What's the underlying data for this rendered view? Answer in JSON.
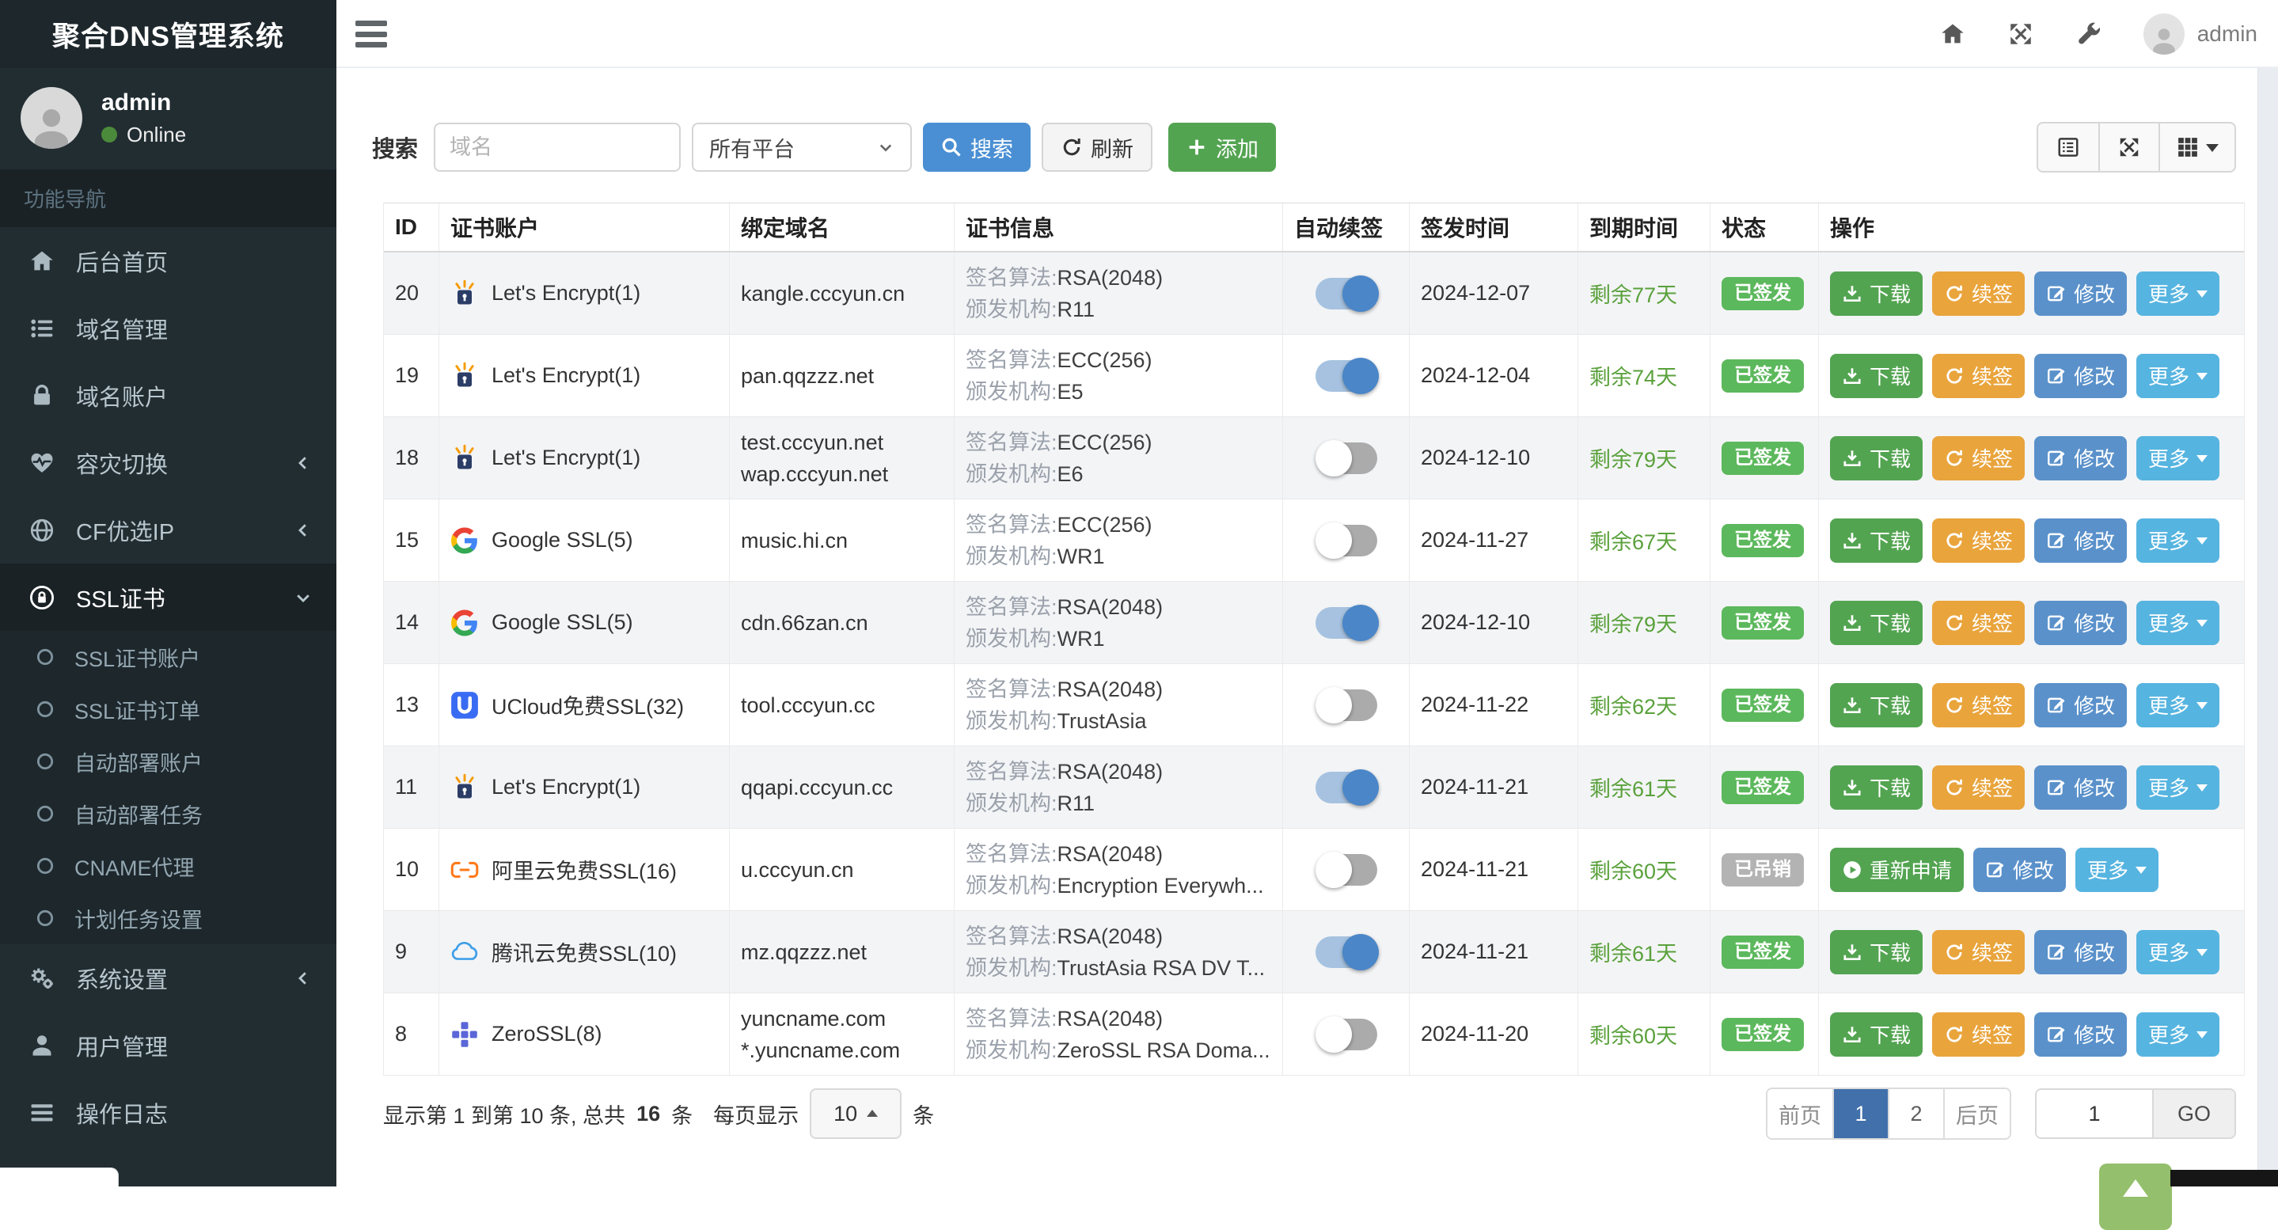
{
  "app": {
    "title": "聚合DNS管理系统"
  },
  "topbar": {
    "username": "admin"
  },
  "sidebar": {
    "user": {
      "name": "admin",
      "status": "Online"
    },
    "section_label": "功能导航",
    "items": [
      {
        "label": "后台首页",
        "icon": "home-icon"
      },
      {
        "label": "域名管理",
        "icon": "list-icon"
      },
      {
        "label": "域名账户",
        "icon": "lock-icon"
      },
      {
        "label": "容灾切换",
        "icon": "heartbeat-icon"
      },
      {
        "label": "CF优选IP",
        "icon": "globe-icon"
      },
      {
        "label": "SSL证书",
        "icon": "ssl-lock-icon",
        "expanded": true
      },
      {
        "label": "系统设置",
        "icon": "gears-icon"
      },
      {
        "label": "用户管理",
        "icon": "user-icon"
      },
      {
        "label": "操作日志",
        "icon": "log-icon"
      }
    ],
    "ssl_submenu": [
      "SSL证书账户",
      "SSL证书订单",
      "自动部署账户",
      "自动部署任务",
      "CNAME代理",
      "计划任务设置"
    ]
  },
  "search": {
    "label": "搜索",
    "placeholder": "域名",
    "platform_selected": "所有平台",
    "search_btn": "搜索",
    "refresh_btn": "刷新",
    "add_btn": "添加"
  },
  "table": {
    "headers": [
      "ID",
      "证书账户",
      "绑定域名",
      "证书信息",
      "自动续签",
      "签发时间",
      "到期时间",
      "状态",
      "操作"
    ],
    "labels": {
      "algo": "签名算法:",
      "issuer": "颁发机构:"
    },
    "actions": {
      "download": "下载",
      "renew": "续签",
      "edit": "修改",
      "more": "更多",
      "reapply": "重新申请"
    },
    "rows": [
      {
        "id": "20",
        "provider": "letsencrypt",
        "account": "Let's Encrypt(1)",
        "domains": [
          "kangle.cccyun.cn"
        ],
        "algo": "RSA(2048)",
        "issuer": "R11",
        "auto_renew": true,
        "issued": "2024-12-07",
        "expires": "剩余77天",
        "status": "已签发",
        "status_type": "issued"
      },
      {
        "id": "19",
        "provider": "letsencrypt",
        "account": "Let's Encrypt(1)",
        "domains": [
          "pan.qqzzz.net"
        ],
        "algo": "ECC(256)",
        "issuer": "E5",
        "auto_renew": true,
        "issued": "2024-12-04",
        "expires": "剩余74天",
        "status": "已签发",
        "status_type": "issued"
      },
      {
        "id": "18",
        "provider": "letsencrypt",
        "account": "Let's Encrypt(1)",
        "domains": [
          "test.cccyun.net",
          "wap.cccyun.net"
        ],
        "algo": "ECC(256)",
        "issuer": "E6",
        "auto_renew": false,
        "issued": "2024-12-10",
        "expires": "剩余79天",
        "status": "已签发",
        "status_type": "issued"
      },
      {
        "id": "15",
        "provider": "google",
        "account": "Google SSL(5)",
        "domains": [
          "music.hi.cn"
        ],
        "algo": "ECC(256)",
        "issuer": "WR1",
        "auto_renew": false,
        "issued": "2024-11-27",
        "expires": "剩余67天",
        "status": "已签发",
        "status_type": "issued"
      },
      {
        "id": "14",
        "provider": "google",
        "account": "Google SSL(5)",
        "domains": [
          "cdn.66zan.cn"
        ],
        "algo": "RSA(2048)",
        "issuer": "WR1",
        "auto_renew": true,
        "issued": "2024-12-10",
        "expires": "剩余79天",
        "status": "已签发",
        "status_type": "issued"
      },
      {
        "id": "13",
        "provider": "ucloud",
        "account": "UCloud免费SSL(32)",
        "domains": [
          "tool.cccyun.cc"
        ],
        "algo": "RSA(2048)",
        "issuer": "TrustAsia",
        "auto_renew": false,
        "issued": "2024-11-22",
        "expires": "剩余62天",
        "status": "已签发",
        "status_type": "issued"
      },
      {
        "id": "11",
        "provider": "letsencrypt",
        "account": "Let's Encrypt(1)",
        "domains": [
          "qqapi.cccyun.cc"
        ],
        "algo": "RSA(2048)",
        "issuer": "R11",
        "auto_renew": true,
        "issued": "2024-11-21",
        "expires": "剩余61天",
        "status": "已签发",
        "status_type": "issued"
      },
      {
        "id": "10",
        "provider": "aliyun",
        "account": "阿里云免费SSL(16)",
        "domains": [
          "u.cccyun.cn"
        ],
        "algo": "RSA(2048)",
        "issuer": "Encryption Everywh...",
        "auto_renew": false,
        "issued": "2024-11-21",
        "expires": "剩余60天",
        "status": "已吊销",
        "status_type": "revoked"
      },
      {
        "id": "9",
        "provider": "tencent",
        "account": "腾讯云免费SSL(10)",
        "domains": [
          "mz.qqzzz.net"
        ],
        "algo": "RSA(2048)",
        "issuer": "TrustAsia RSA DV T...",
        "auto_renew": true,
        "issued": "2024-11-21",
        "expires": "剩余61天",
        "status": "已签发",
        "status_type": "issued"
      },
      {
        "id": "8",
        "provider": "zerossl",
        "account": "ZeroSSL(8)",
        "domains": [
          "yuncname.com",
          "*.yuncname.com"
        ],
        "algo": "RSA(2048)",
        "issuer": "ZeroSSL RSA Doma...",
        "auto_renew": false,
        "issued": "2024-11-20",
        "expires": "剩余60天",
        "status": "已签发",
        "status_type": "issued"
      }
    ]
  },
  "pagination": {
    "summary_prefix": "显示第 1 到第 10 条, 总共",
    "total": "16",
    "summary_suffix": "条",
    "per_page_label": "每页显示",
    "page_size": "10",
    "unit": "条",
    "prev": "前页",
    "page1": "1",
    "page2": "2",
    "next": "后页",
    "jump_value": "1",
    "go_label": "GO"
  },
  "colors": {
    "sidebar_bg": "#222d32",
    "primary_blue": "#4a8fd3",
    "success_green": "#53a451",
    "warning_orange": "#e9a43c",
    "edit_blue": "#5a91ca",
    "info_blue": "#56b4e0",
    "issued_badge": "#5cb85c",
    "revoked_badge": "#b3b3b3",
    "expiry_green": "#5aa13c",
    "active_page_blue": "#4170ab",
    "toggle_on_blue": "#4a86c8"
  }
}
